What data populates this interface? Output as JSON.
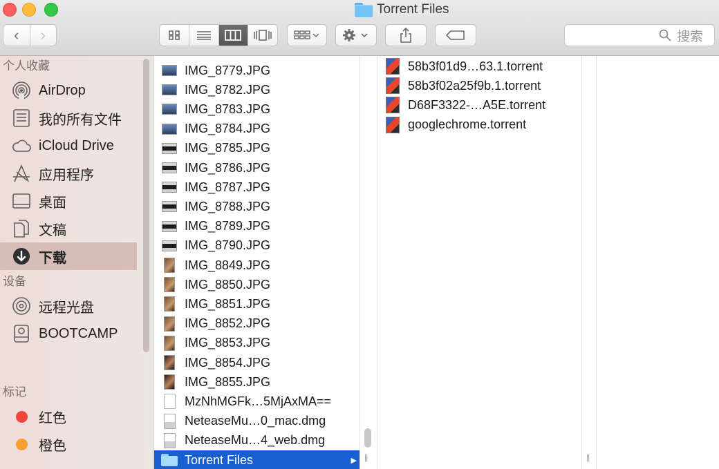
{
  "window": {
    "title": "Torrent Files",
    "title_icon": "folder-icon"
  },
  "toolbar": {
    "back_icon": "‹",
    "forward_icon": "›",
    "view_modes": [
      "icon-view",
      "list-view",
      "column-view",
      "cover-flow-view"
    ],
    "active_view": "column-view",
    "arrange_icon": "arrange-icon",
    "action_icon": "gear-icon",
    "share_icon": "share-icon",
    "tag_icon": "tag-icon",
    "search_placeholder": "搜索"
  },
  "sidebar": {
    "sections": {
      "favorites": "个人收藏",
      "devices": "设备",
      "tags": "标记"
    },
    "favorites": [
      {
        "label": "AirDrop",
        "icon": "airdrop-icon"
      },
      {
        "label": "我的所有文件",
        "icon": "all-files-icon"
      },
      {
        "label": "iCloud Drive",
        "icon": "cloud-icon"
      },
      {
        "label": "应用程序",
        "icon": "applications-icon"
      },
      {
        "label": "桌面",
        "icon": "desktop-icon"
      },
      {
        "label": "文稿",
        "icon": "documents-icon"
      },
      {
        "label": "下载",
        "icon": "downloads-icon",
        "selected": true
      }
    ],
    "devices": [
      {
        "label": "远程光盘",
        "icon": "disc-icon"
      },
      {
        "label": "BOOTCAMP",
        "icon": "disk-icon"
      }
    ],
    "tags": [
      {
        "label": "红色",
        "color": "#f0473d"
      },
      {
        "label": "橙色",
        "color": "#f5a030"
      }
    ]
  },
  "column1": {
    "items": [
      {
        "name": "IMG_8779.JPG",
        "icon": "image-icon"
      },
      {
        "name": "IMG_8782.JPG",
        "icon": "image-icon"
      },
      {
        "name": "IMG_8783.JPG",
        "icon": "image-icon"
      },
      {
        "name": "IMG_8784.JPG",
        "icon": "image-icon"
      },
      {
        "name": "IMG_8785.JPG",
        "icon": "image-icon"
      },
      {
        "name": "IMG_8786.JPG",
        "icon": "image-icon"
      },
      {
        "name": "IMG_8787.JPG",
        "icon": "image-icon"
      },
      {
        "name": "IMG_8788.JPG",
        "icon": "image-icon"
      },
      {
        "name": "IMG_8789.JPG",
        "icon": "image-icon"
      },
      {
        "name": "IMG_8790.JPG",
        "icon": "image-icon"
      },
      {
        "name": "IMG_8849.JPG",
        "icon": "image-icon"
      },
      {
        "name": "IMG_8850.JPG",
        "icon": "image-icon"
      },
      {
        "name": "IMG_8851.JPG",
        "icon": "image-icon"
      },
      {
        "name": "IMG_8852.JPG",
        "icon": "image-icon"
      },
      {
        "name": "IMG_8853.JPG",
        "icon": "image-icon"
      },
      {
        "name": "IMG_8854.JPG",
        "icon": "image-icon"
      },
      {
        "name": "IMG_8855.JPG",
        "icon": "image-icon"
      },
      {
        "name": "MzNhMGFk…5MjAxMA==",
        "icon": "document-icon"
      },
      {
        "name": "NeteaseMu…0_mac.dmg",
        "icon": "dmg-icon"
      },
      {
        "name": "NeteaseMu…4_web.dmg",
        "icon": "dmg-icon"
      },
      {
        "name": "Torrent Files",
        "icon": "folder-icon",
        "selected": true
      }
    ]
  },
  "column2": {
    "items": [
      {
        "name": "58b3f01d9…63.1.torrent",
        "icon": "torrent-icon"
      },
      {
        "name": "58b3f02a25f9b.1.torrent",
        "icon": "torrent-icon"
      },
      {
        "name": "D68F3322-…A5E.torrent",
        "icon": "torrent-icon"
      },
      {
        "name": "googlechrome.torrent",
        "icon": "torrent-icon"
      }
    ]
  },
  "colors": {
    "selection": "#1a5fd1",
    "sidebar_selected": "#d6bdb8"
  }
}
